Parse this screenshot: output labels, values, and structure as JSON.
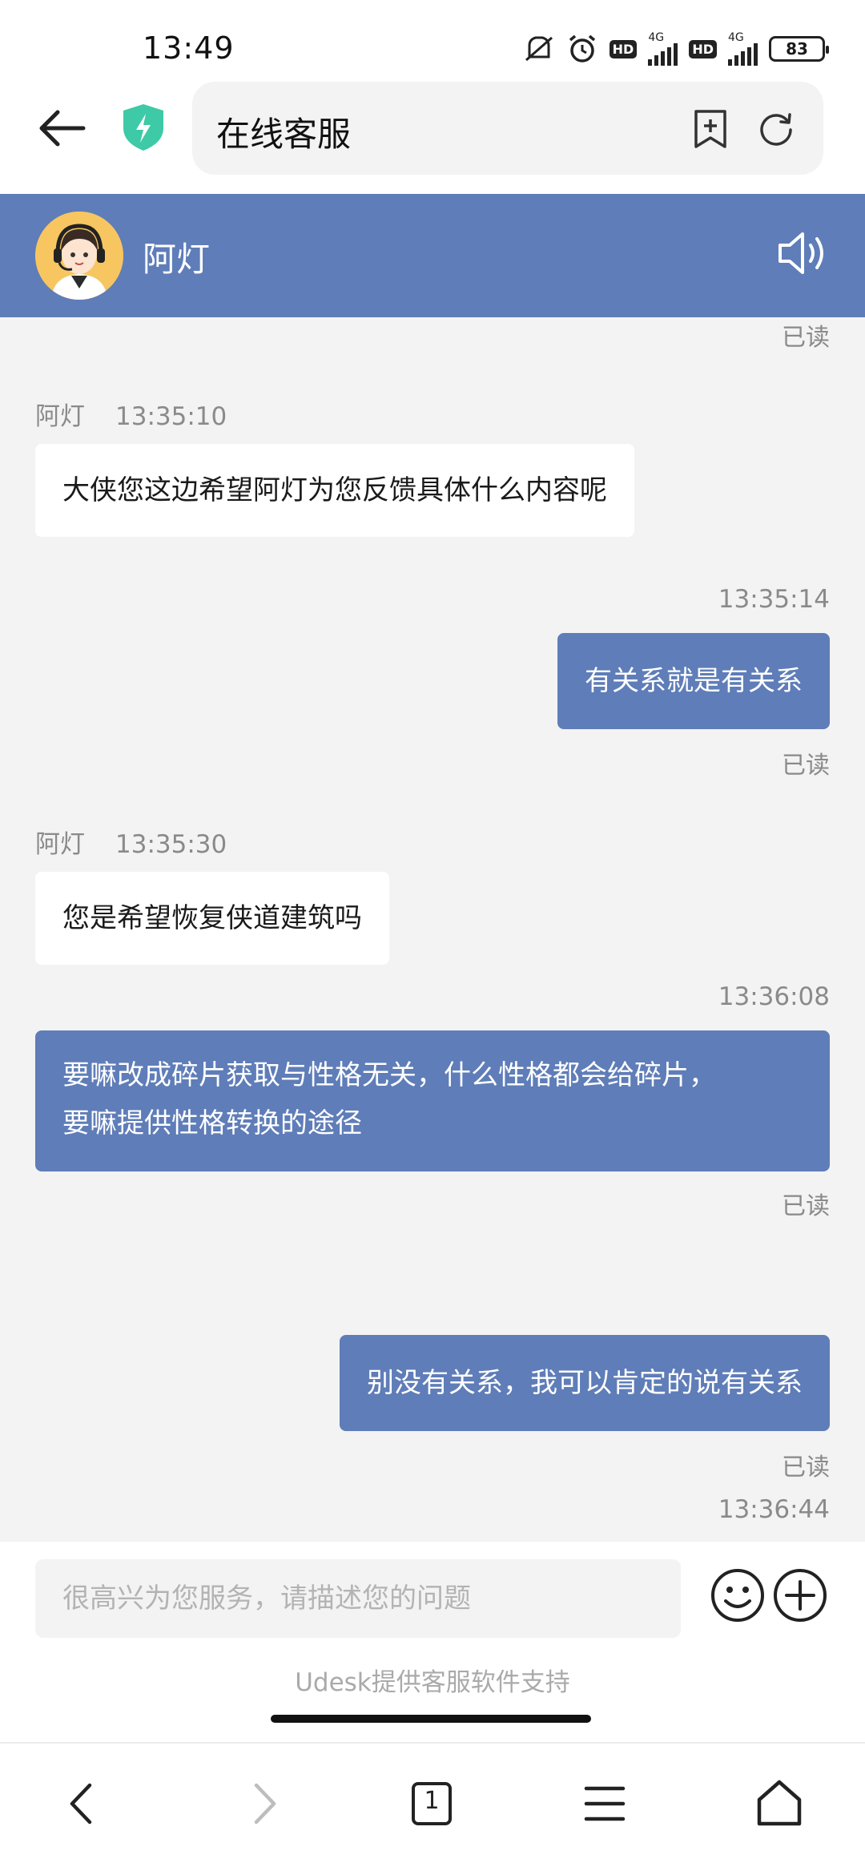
{
  "status_bar": {
    "time": "13:49",
    "hd_label": "HD",
    "net_label": "4G",
    "battery": "83",
    "icons": [
      "mute-icon",
      "alarm-icon",
      "signal-icon",
      "battery-icon"
    ]
  },
  "browser": {
    "title": "在线客服",
    "icons": [
      "back-arrow-icon",
      "shield-bolt-icon",
      "bookmark-add-icon",
      "refresh-icon"
    ]
  },
  "chat_header": {
    "agent_name": "阿灯",
    "icons": [
      "avatar-icon",
      "speaker-icon"
    ]
  },
  "chat": {
    "top_read": "已读",
    "messages": [
      {
        "sender": "阿灯",
        "time": "13:35:10",
        "text": "大侠您这边希望阿灯为您反馈具体什么内容呢"
      },
      {
        "time": "13:35:14",
        "text": "有关系就是有关系",
        "status": "已读"
      },
      {
        "sender": "阿灯",
        "time": "13:35:30",
        "text": "您是希望恢复侠道建筑吗"
      },
      {
        "time": "13:36:08",
        "line1": "要嘛改成碎片获取与性格无关，什么性格都会给碎片，",
        "line2": "要嘛提供性格转换的途径",
        "status": "已读"
      },
      {
        "text": "别没有关系，我可以肯定的说有关系",
        "status": "已读"
      },
      {
        "time": "13:36:44"
      }
    ]
  },
  "input": {
    "placeholder": "很高兴为您服务，请描述您的问题",
    "value": "",
    "powered_by": "Udesk提供客服软件支持"
  },
  "bottom_nav": {
    "tab_count": "1",
    "icons": [
      "nav-back-icon",
      "nav-forward-icon",
      "tabs-icon",
      "menu-icon",
      "home-icon"
    ]
  },
  "colors": {
    "accent": "#5f7db8",
    "chat_bg": "#f3f3f3",
    "shield": "#3ec9a7"
  }
}
